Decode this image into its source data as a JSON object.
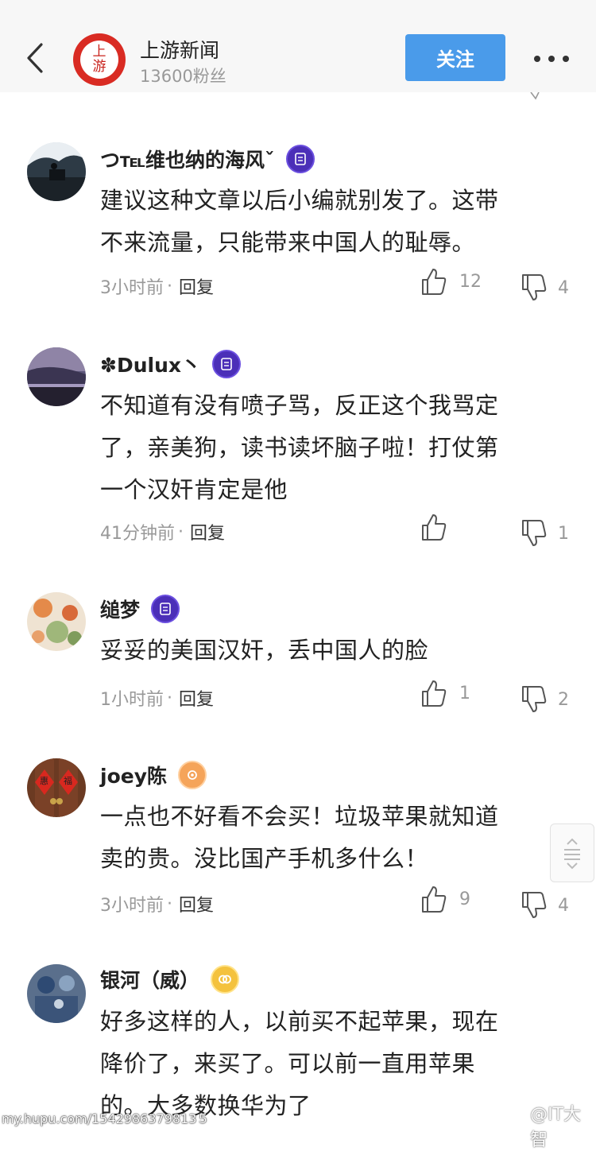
{
  "header": {
    "channel_name": "上游新闻",
    "fans": "13600粉丝",
    "follow_label": "关注",
    "logo_text_top": "上",
    "logo_text_bottom": "游"
  },
  "comments": [
    {
      "username": "つ℡维也纳的海风ˇ",
      "badge": "purple",
      "lines": [
        "建议这种文章以后小编就别发了。这带",
        "不来流量，只能带来中国人的耻辱。"
      ],
      "time": "3小时前",
      "reply_label": "回复",
      "likes": "12",
      "dislikes": "4"
    },
    {
      "username": "✽Dulux丶",
      "badge": "purple",
      "lines": [
        "不知道有没有喷子骂，反正这个我骂定",
        "了，亲美狗，读书读坏脑子啦！打仗第",
        "一个汉奸肯定是他"
      ],
      "time": "41分钟前",
      "reply_label": "回复",
      "likes": "",
      "dislikes": "1"
    },
    {
      "username": "缒梦",
      "badge": "purple",
      "lines": [
        "妥妥的美国汉奸，丢中国人的脸"
      ],
      "time": "1小时前",
      "reply_label": "回复",
      "likes": "1",
      "dislikes": "2"
    },
    {
      "username": "joey陈",
      "badge": "orange",
      "lines": [
        "一点也不好看不会买！垃圾苹果就知道",
        "卖的贵。没比国产手机多什么！"
      ],
      "time": "3小时前",
      "reply_label": "回复",
      "likes": "9",
      "dislikes": "4"
    },
    {
      "username": "银河（威）",
      "badge": "gold",
      "lines": [
        "好多这样的人，以前买不起苹果，现在",
        "降价了，来买了。可以前一直用苹果",
        "的。大多数换华为了"
      ],
      "time": "",
      "reply_label": "",
      "likes": "",
      "dislikes": ""
    }
  ],
  "meta_separator": "·",
  "avatar_2_text_left": "惠",
  "avatar_2_text_right": "福",
  "watermark_left": "my.hupu.com/1542986379813５",
  "watermark_right": "@IT大智",
  "colors": {
    "follow_button": "#4a9bea",
    "logo_red": "#d92b23",
    "badge_purple": "#4b2fb8",
    "badge_orange": "#f5a45a",
    "badge_gold": "#f4c23d"
  }
}
